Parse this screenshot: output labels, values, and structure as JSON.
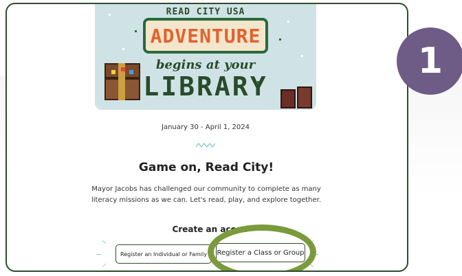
{
  "banner": {
    "top_text": "READ CITY USA",
    "adventure": "ADVENTURE",
    "begins": "begins at your",
    "library": "LIBRARY"
  },
  "event": {
    "dates": "January 30 - April 1, 2024",
    "title": "Game on, Read City!",
    "description": "Mayor Jacobs has challenged our community to complete as many literacy missions as we can. Let's read, play, and explore together."
  },
  "register": {
    "heading": "Create an accou",
    "individual_label": "Register an Individual or Family",
    "group_label": "Register a Class or Group"
  },
  "step_badge": {
    "number": "1",
    "color": "#6e5b86"
  },
  "colors": {
    "frame": "#2f4a2e",
    "highlight_ring": "#7b9a3c",
    "accent": "#e2622d"
  }
}
